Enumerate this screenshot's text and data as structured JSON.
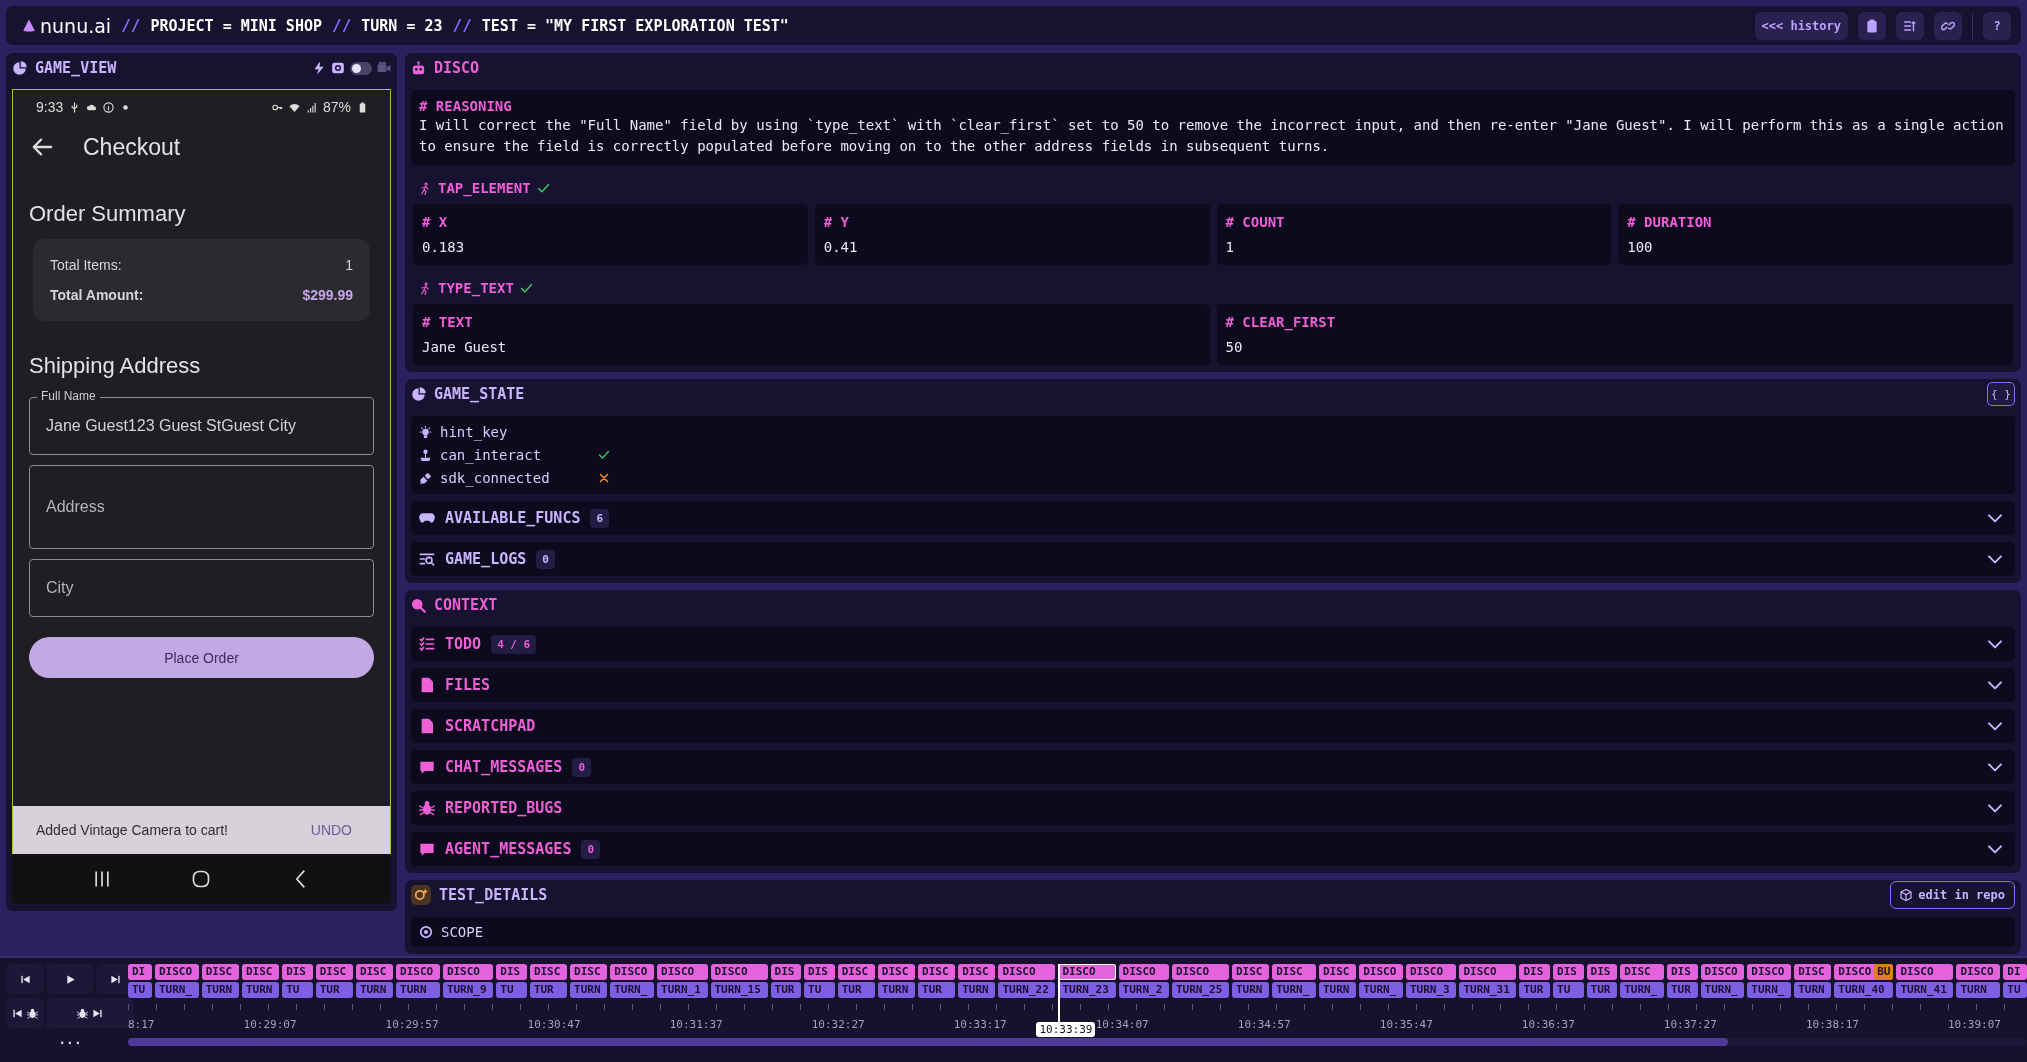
{
  "header": {
    "logo": "nunu.ai",
    "segments": [
      {
        "separator": "//",
        "text": "PROJECT = MINI SHOP"
      },
      {
        "separator": "//",
        "text": "TURN = 23"
      },
      {
        "separator": "//",
        "text": "TEST = \"MY FIRST EXPLORATION TEST\""
      }
    ],
    "history_button": "<<< history",
    "help_button": "?"
  },
  "game_view": {
    "title": "GAME_VIEW",
    "toggle": {
      "on": false
    },
    "phone": {
      "time": "9:33",
      "battery": "87%",
      "title": "Checkout",
      "summary_title": "Order Summary",
      "summary": [
        {
          "kind": "plain",
          "label": "Total Items:",
          "value": "1"
        },
        {
          "kind": "total",
          "label": "Total Amount:",
          "value": "$299.99"
        }
      ],
      "shipping_title": "Shipping Address",
      "fields": [
        {
          "label": "Full Name",
          "value": "Jane Guest123 Guest StGuest City"
        },
        {
          "placeholder": "Address",
          "kind": "tall"
        },
        {
          "placeholder": "City"
        }
      ],
      "button": "Place Order",
      "snackbar": {
        "message": "Added Vintage Camera to cart!",
        "action": "UNDO"
      }
    }
  },
  "disco": {
    "title": "DISCO",
    "reasoning_label": "# REASONING",
    "reasoning": "I will correct the \"Full Name\" field by using `type_text` with `clear_first` set to 50 to remove the incorrect input, and then re-enter \"Jane Guest\". I will perform this as a single action to ensure the field is correctly populated before moving on to the other address fields in subsequent turns.",
    "actions": [
      {
        "name": "TAP_ELEMENT",
        "done": true,
        "params": [
          {
            "label": "# X",
            "value": "0.183"
          },
          {
            "label": "# Y",
            "value": "0.41"
          },
          {
            "label": "# COUNT",
            "value": "1"
          },
          {
            "label": "# DURATION",
            "value": "100"
          }
        ]
      },
      {
        "name": "TYPE_TEXT",
        "done": true,
        "params": [
          {
            "label": "# TEXT",
            "value": "Jane Guest"
          },
          {
            "label": "# CLEAR_FIRST",
            "value": "50"
          }
        ]
      }
    ]
  },
  "game_state": {
    "title": "GAME_STATE",
    "json_button": "{ }",
    "props": [
      {
        "kind": "bulb",
        "name": "hint_key"
      },
      {
        "kind": "joystick",
        "name": "can_interact",
        "ok": true
      },
      {
        "kind": "plug",
        "name": "sdk_connected",
        "ok": false
      }
    ],
    "sections": [
      {
        "kind": "gamepad",
        "label": "AVAILABLE_FUNCS",
        "count": "6",
        "expanded": false
      },
      {
        "kind": "logs",
        "label": "GAME_LOGS",
        "count": "0",
        "expanded": false
      }
    ]
  },
  "context": {
    "title": "CONTEXT",
    "sections": [
      {
        "kind": "checklist",
        "label": "TODO",
        "count": "4 / 6",
        "expanded": false
      },
      {
        "kind": "file",
        "label": "FILES",
        "expanded": false
      },
      {
        "kind": "file",
        "label": "SCRATCHPAD",
        "expanded": false
      },
      {
        "kind": "chat",
        "label": "CHAT_MESSAGES",
        "count": "0",
        "expanded": false
      },
      {
        "kind": "bug",
        "label": "REPORTED_BUGS",
        "expanded": false
      },
      {
        "kind": "chat",
        "label": "AGENT_MESSAGES",
        "count": "0",
        "expanded": false
      }
    ]
  },
  "test_details": {
    "title": "TEST_DETAILS",
    "edit_button": "edit in repo",
    "scope": "SCOPE"
  },
  "timeline": {
    "more": "...",
    "current_time": "10:33:39",
    "turns": [
      {
        "agent": "DI",
        "turn": "TU",
        "selected": false
      },
      {
        "agent": "DISCO",
        "turn": "TURN_",
        "selected": false
      },
      {
        "agent": "DISC",
        "turn": "TURN",
        "selected": false
      },
      {
        "agent": "DISC",
        "turn": "TURN",
        "selected": false
      },
      {
        "agent": "DIS",
        "turn": "TU",
        "selected": false
      },
      {
        "agent": "DISC",
        "turn": "TUR",
        "selected": false
      },
      {
        "agent": "DISC",
        "turn": "TURN",
        "selected": false
      },
      {
        "agent": "DISCO",
        "turn": "TURN",
        "selected": false
      },
      {
        "agent": "DISCO",
        "turn": "TURN_9",
        "selected": false
      },
      {
        "agent": "DIS",
        "turn": "TU",
        "selected": false
      },
      {
        "agent": "DISC",
        "turn": "TUR",
        "selected": false
      },
      {
        "agent": "DISC",
        "turn": "TURN",
        "selected": false
      },
      {
        "agent": "DISCO",
        "turn": "TURN_",
        "selected": false
      },
      {
        "agent": "DISCO",
        "turn": "TURN_1",
        "selected": false
      },
      {
        "agent": "DISCO",
        "turn": "TURN_15",
        "selected": false
      },
      {
        "agent": "DIS",
        "turn": "TUR",
        "selected": false
      },
      {
        "agent": "DIS",
        "turn": "TU",
        "selected": false
      },
      {
        "agent": "DISC",
        "turn": "TUR",
        "selected": false
      },
      {
        "agent": "DISC",
        "turn": "TURN",
        "selected": false
      },
      {
        "agent": "DISC",
        "turn": "TUR",
        "selected": false
      },
      {
        "agent": "DISC",
        "turn": "TURN",
        "selected": false
      },
      {
        "agent": "DISCO",
        "turn": "TURN_22",
        "selected": false
      },
      {
        "agent": "DISCO",
        "turn": "TURN_23",
        "selected": true
      },
      {
        "agent": "DISCO",
        "turn": "TURN_2",
        "selected": false
      },
      {
        "agent": "DISCO",
        "turn": "TURN_25",
        "selected": false
      },
      {
        "agent": "DISC",
        "turn": "TURN",
        "selected": false
      },
      {
        "agent": "DISC",
        "turn": "TURN_",
        "selected": false
      },
      {
        "agent": "DISC",
        "turn": "TURN",
        "selected": false
      },
      {
        "agent": "DISCO",
        "turn": "TURN_",
        "selected": false
      },
      {
        "agent": "DISCO",
        "turn": "TURN_3",
        "selected": false
      },
      {
        "agent": "DISCO",
        "turn": "TURN_31",
        "selected": false
      },
      {
        "agent": "DIS",
        "turn": "TUR",
        "selected": false
      },
      {
        "agent": "DIS",
        "turn": "TU",
        "selected": false
      },
      {
        "agent": "DIS",
        "turn": "TUR",
        "selected": false
      },
      {
        "agent": "DISC",
        "turn": "TURN_",
        "selected": false
      },
      {
        "agent": "DIS",
        "turn": "TUR",
        "selected": false
      },
      {
        "agent": "DISCO",
        "turn": "TURN_",
        "selected": false
      },
      {
        "agent": "DISCO",
        "turn": "TURN_",
        "selected": false
      },
      {
        "agent": "DISC",
        "turn": "TURN",
        "selected": false
      },
      {
        "agent": "DISCO",
        "turn": "TURN_40",
        "bug": "BU",
        "selected": false
      },
      {
        "agent": "DISCO",
        "turn": "TURN_41",
        "selected": false
      },
      {
        "agent": "DISCO",
        "turn": "TURN",
        "selected": false
      },
      {
        "agent": "DI",
        "turn": "TU",
        "selected": false
      }
    ],
    "ticks": [
      "8:17",
      "10:29:07",
      "10:29:57",
      "10:30:47",
      "10:31:37",
      "10:32:27",
      "10:33:17",
      "10:34:07",
      "10:34:57",
      "10:35:47",
      "10:36:37",
      "10:37:27",
      "10:38:17",
      "10:39:07"
    ]
  }
}
